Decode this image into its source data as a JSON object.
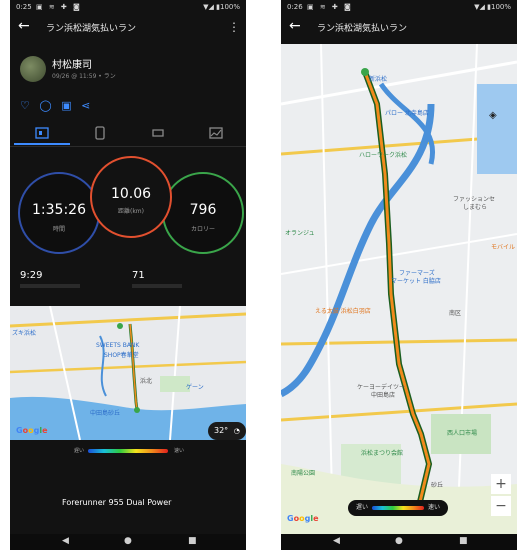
{
  "colors": {
    "accent": "#3d8bff",
    "ring_time": "#2f4ea8",
    "ring_distance": "#e2502f",
    "ring_calories": "#3aa54a"
  },
  "left": {
    "status": {
      "time": "0:25",
      "battery": "▼◢ ▮100%"
    },
    "title": "ラン浜松湖気払いラン",
    "user": {
      "name": "村松康司",
      "meta": "09/26 @ 11:59 • ラン"
    },
    "social_icons": [
      "heart-icon",
      "comment-icon",
      "add-photo-icon",
      "share-icon"
    ],
    "tabs": [
      "summary-tab-icon",
      "device-tab-icon",
      "laps-tab-icon",
      "chart-tab-icon"
    ],
    "rings": {
      "time": {
        "value": "1:35:26",
        "label": "時間"
      },
      "distance": {
        "value": "10.06",
        "label": "距離(km)"
      },
      "calories": {
        "value": "796",
        "label": "カロリー"
      }
    },
    "stats": [
      {
        "value": "9:29"
      },
      {
        "value": "71"
      }
    ],
    "map_labels": [
      "ズキ浜松",
      "SWEETS BANK",
      "SHOP春華堂",
      "浜北",
      "中田島砂丘",
      "ゲーン"
    ],
    "temperature": "32°",
    "legend": {
      "slow": "遅い",
      "fast": "速い"
    },
    "device": "Forerunner 955 Dual Power"
  },
  "right": {
    "status": {
      "time": "0:26",
      "battery": "▼◢ ▮100%"
    },
    "title": "ラン浜松湖気払いラン",
    "map_labels": {
      "shinhamamatsu": "新浜松",
      "parlor": "パロー 北寺島店",
      "harold": "ハローワーク浜松",
      "fashion1": "ファッションセ",
      "fashion2": "しまむら",
      "orange": "オランジュ",
      "mobile": "モバイル",
      "farmers1": "ファーマーズ",
      "farmers2": "マーケット 白脇店",
      "ekodono": "える太鼓 浜松白羽店",
      "minamiku": "南区",
      "keiyo1": "ケーヨーデイツー",
      "keiyo2": "中田島店",
      "nishiku": "西人口市場",
      "hamamatsu_matsuri": "浜松まつり会館",
      "nagusa": "南陽公園",
      "sand": "砂丘"
    },
    "legend": {
      "slow": "遅い",
      "fast": "速い"
    },
    "zoom": {
      "plus": "+",
      "minus": "−"
    }
  }
}
